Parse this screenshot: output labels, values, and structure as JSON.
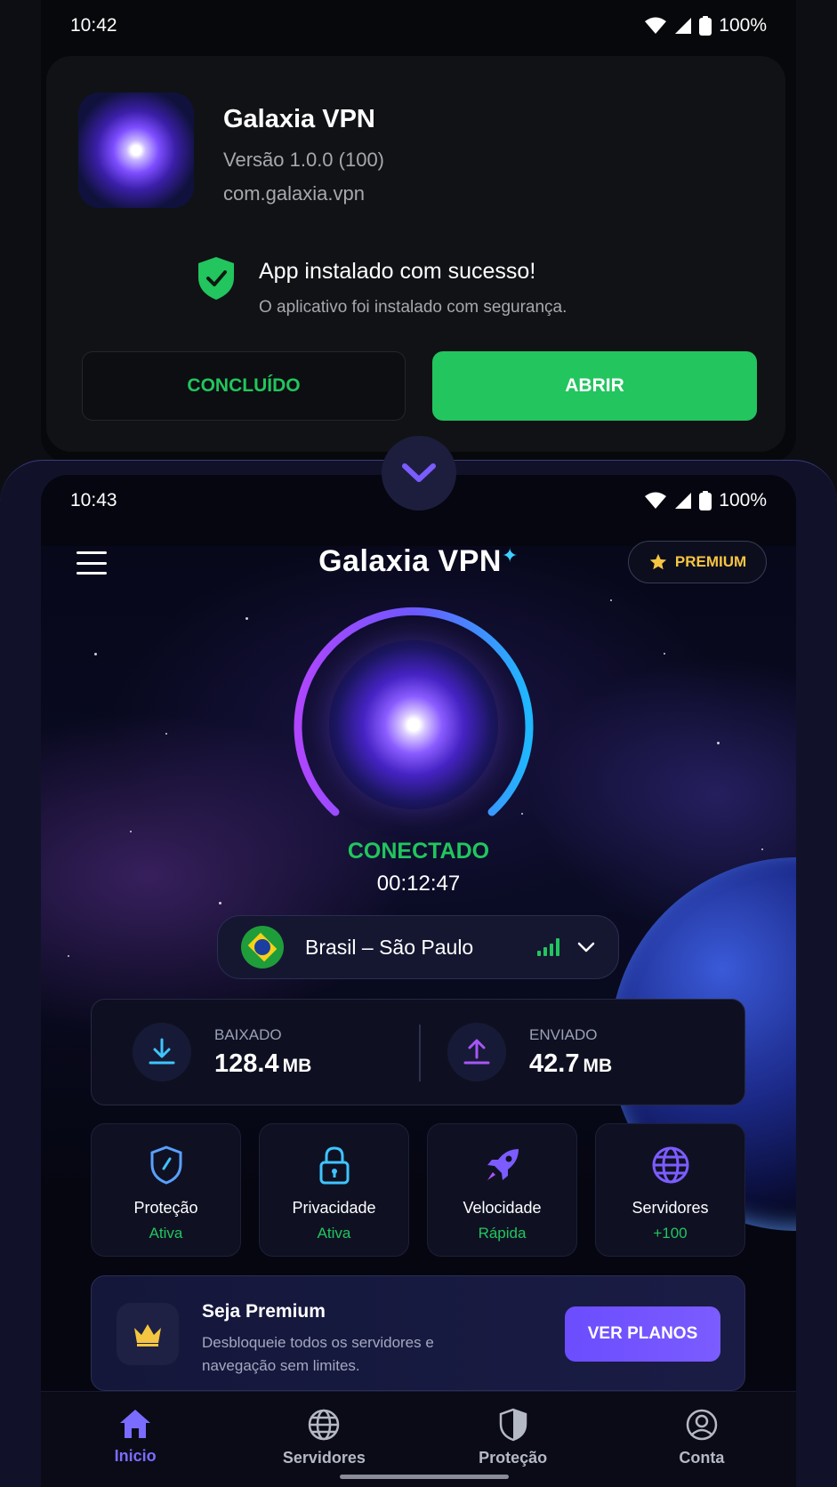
{
  "top_device": {
    "status_bar": {
      "time": "10:42",
      "battery": "100%"
    },
    "installer": {
      "app_name": "Galaxia VPN",
      "version": "Versão 1.0.0 (100)",
      "package": "com.galaxia.vpn",
      "success_title": "App instalado com sucesso!",
      "success_subtitle": "O aplicativo foi instalado com segurança.",
      "done_button": "CONCLUÍDO",
      "open_button": "ABRIR"
    }
  },
  "bottom_device": {
    "status_bar": {
      "time": "10:43",
      "battery": "100%"
    },
    "header": {
      "brand": "Galaxia VPN",
      "premium_label": "PREMIUM"
    },
    "connection": {
      "status": "CONECTADO",
      "timer": "00:12:47"
    },
    "location": {
      "country_city": "Brasil – São Paulo",
      "signal_icon": "signal-bars-icon"
    },
    "traffic": {
      "download": {
        "label": "BAIXADO",
        "value": "128.4",
        "unit": "MB"
      },
      "upload": {
        "label": "ENVIADO",
        "value": "42.7",
        "unit": "MB"
      }
    },
    "features": [
      {
        "name": "Proteção",
        "state": "Ativa",
        "icon": "shield-icon"
      },
      {
        "name": "Privacidade",
        "state": "Ativa",
        "icon": "lock-icon"
      },
      {
        "name": "Velocidade",
        "state": "Rápida",
        "icon": "rocket-icon"
      },
      {
        "name": "Servidores",
        "state": "+100",
        "icon": "globe-icon"
      }
    ],
    "premium_card": {
      "title": "Seja Premium",
      "description": "Desbloqueie todos os servidores e navegação sem limites.",
      "button": "VER PLANOS"
    },
    "bottom_nav": [
      {
        "label": "Inicio",
        "icon": "home-icon",
        "active": true
      },
      {
        "label": "Servidores",
        "icon": "globe-icon",
        "active": false
      },
      {
        "label": "Proteção",
        "icon": "shield-icon",
        "active": false
      },
      {
        "label": "Conta",
        "icon": "account-icon",
        "active": false
      }
    ]
  },
  "colors": {
    "accent_green": "#22c55e",
    "accent_purple": "#7a6cff",
    "premium_gold": "#f5c542",
    "background": "#05060f"
  }
}
